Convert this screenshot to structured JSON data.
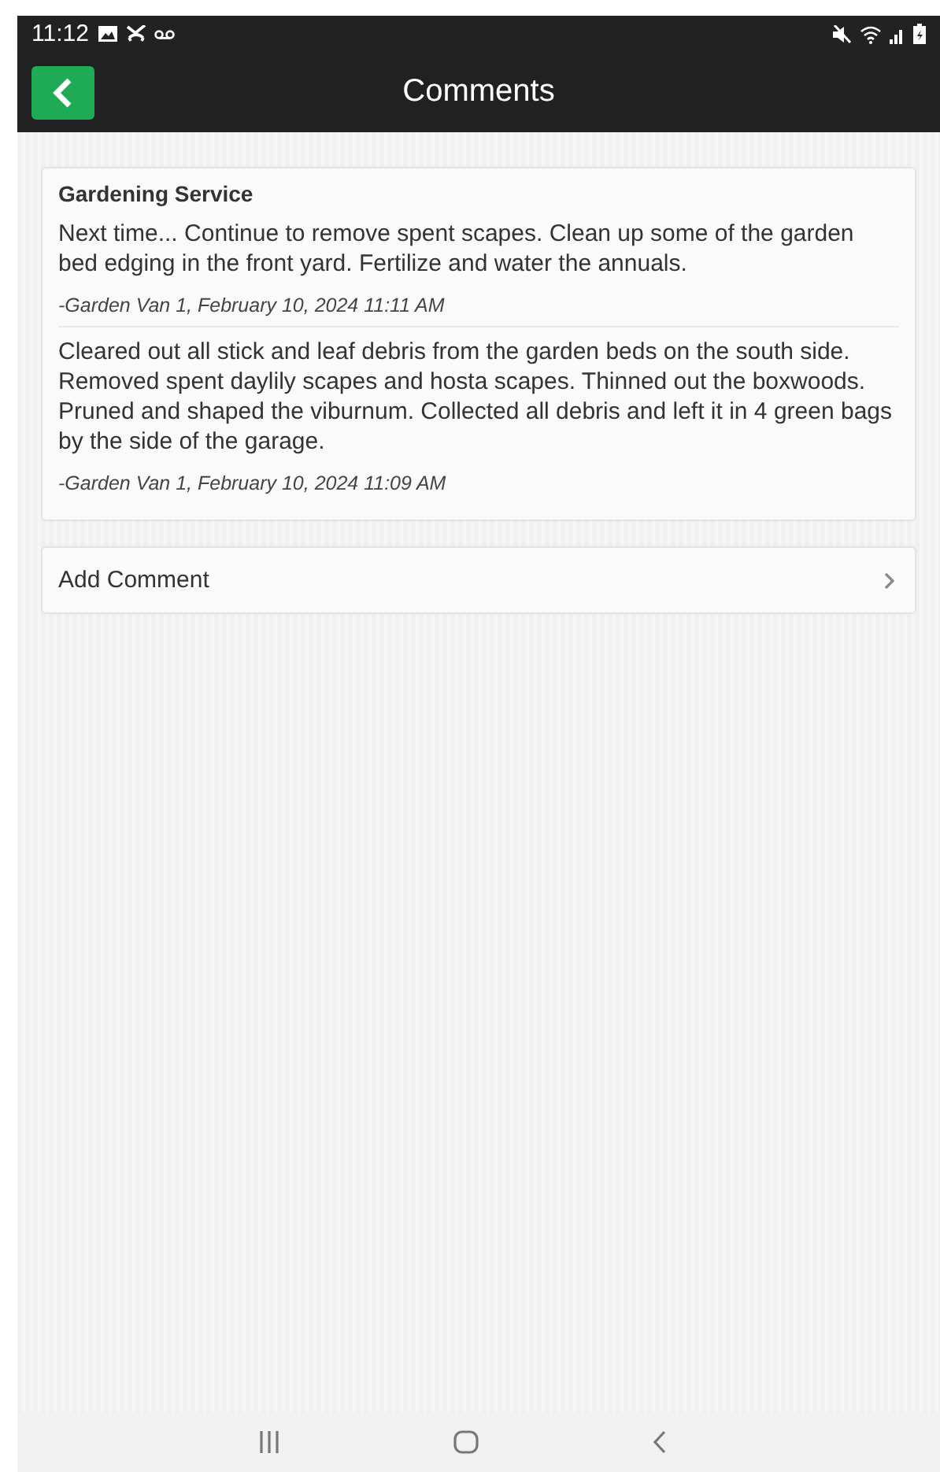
{
  "status_bar": {
    "time": "11:12"
  },
  "header": {
    "title": "Comments"
  },
  "card": {
    "title": "Gardening Service",
    "comments": [
      {
        "text": "Next time... Continue to remove spent scapes. Clean up some of the garden bed edging in the front yard. Fertilize and water the annuals.",
        "author": "-Garden Van 1, February 10, 2024 11:11 AM"
      },
      {
        "text": "Cleared out all stick and leaf debris from the garden beds on the south side. Removed spent daylily scapes and hosta scapes. Thinned out the boxwoods. Pruned and shaped the viburnum. Collected all debris and left it in 4 green bags by the side of the garage.",
        "author": "-Garden Van 1, February 10, 2024 11:09 AM"
      }
    ]
  },
  "add_comment": {
    "label": "Add Comment"
  }
}
